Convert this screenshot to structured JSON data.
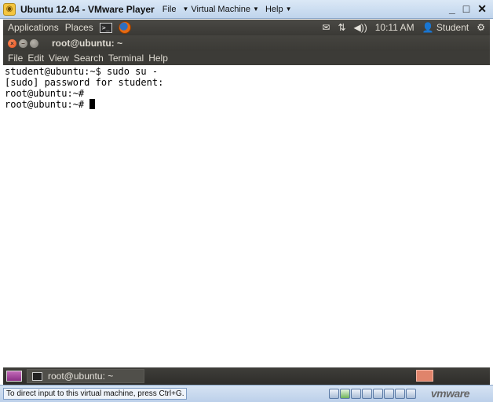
{
  "vmware": {
    "title": "Ubuntu 12.04 - VMware Player",
    "menus": [
      "File",
      "Virtual Machine",
      "Help"
    ],
    "minimize": "_",
    "close": "✕",
    "status_hint": "To direct input to this virtual machine, press Ctrl+G.",
    "brand": "vmware"
  },
  "ubuntu_panel": {
    "applications": "Applications",
    "places": "Places",
    "time": "10:11 AM",
    "user": "Student"
  },
  "terminal": {
    "title": "root@ubuntu: ~",
    "menu": [
      "File",
      "Edit",
      "View",
      "Search",
      "Terminal",
      "Help"
    ],
    "lines": [
      "student@ubuntu:~$ sudo su -",
      "[sudo] password for student:",
      "root@ubuntu:~#",
      "root@ubuntu:~#"
    ]
  },
  "taskbar": {
    "window_label": "root@ubuntu: ~"
  }
}
